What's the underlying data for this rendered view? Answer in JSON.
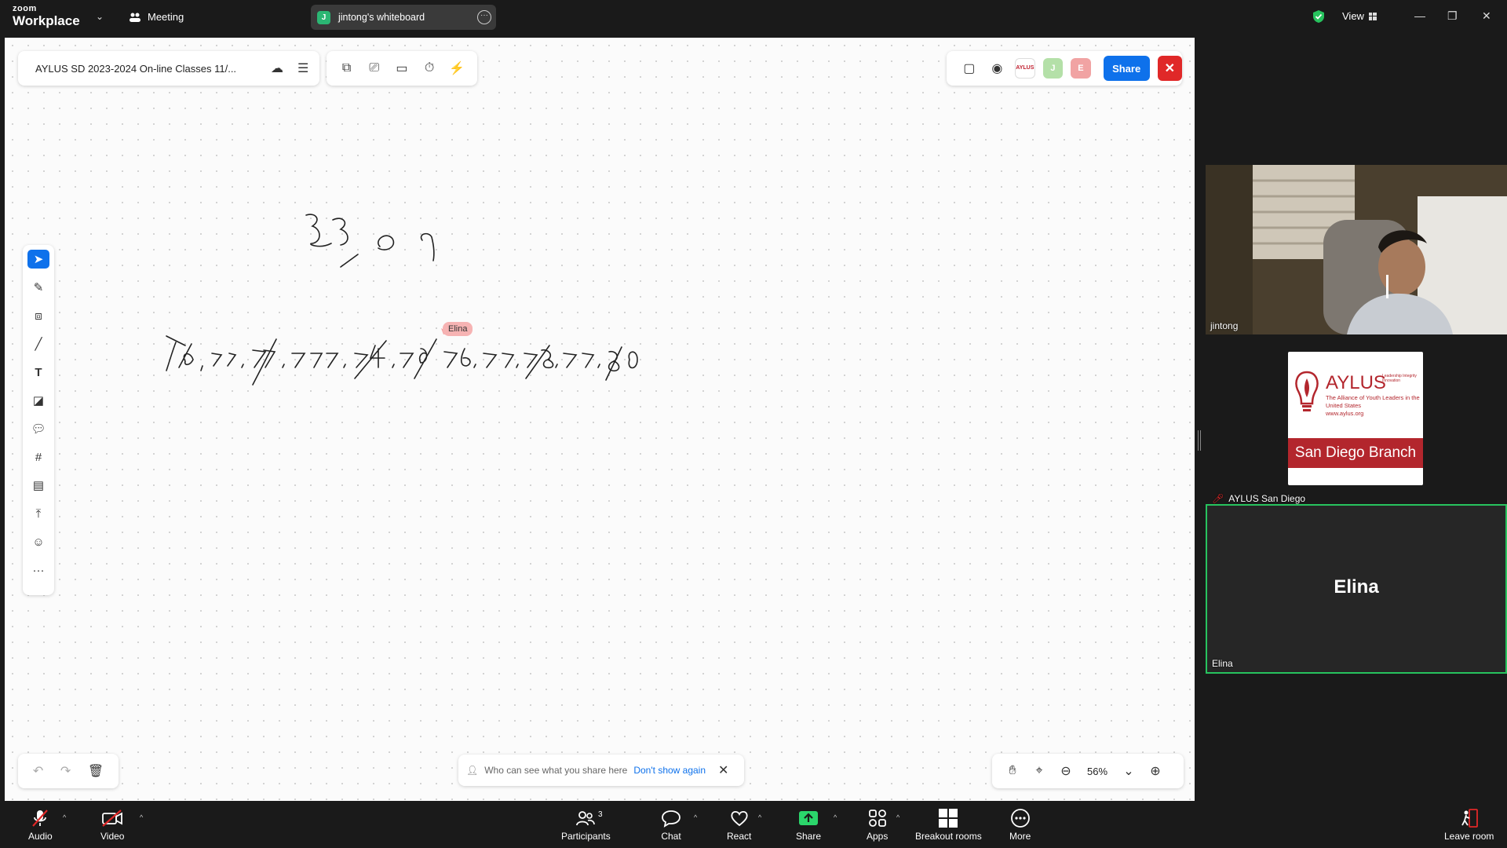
{
  "titlebar": {
    "brand_top": "zoom",
    "brand_bottom": "Workplace",
    "meeting_label": "Meeting",
    "tab_badge": "J",
    "tab_title": "jintong's whiteboard",
    "view_label": "View"
  },
  "whiteboard": {
    "doc_title": "AYLUS SD 2023-2024 On-line Classes 11/...",
    "cursor_label": "Elina",
    "share_label": "Share",
    "avatars": [
      "J",
      "E"
    ],
    "logo_avatar_text": "AYLUS",
    "notice_text": "Who can see what you share here",
    "notice_link": "Don't show again",
    "zoom_level": "56%"
  },
  "participants_panel": {
    "tile1_name": "jintong",
    "tile2_name": "AYLUS San Diego",
    "tile3_name": "Elina",
    "tile3_big": "Elina",
    "logo": {
      "title": "AYLUS",
      "tagline": "The Alliance of Youth Leaders in the United States",
      "url": "www.aylus.org",
      "values": "Leadership Integrity Innovation",
      "branch": "San Diego Branch"
    }
  },
  "bottombar": {
    "audio": "Audio",
    "video": "Video",
    "participants": "Participants",
    "participants_count": "3",
    "chat": "Chat",
    "react": "React",
    "share": "Share",
    "apps": "Apps",
    "breakout": "Breakout rooms",
    "more": "More",
    "leave": "Leave room"
  },
  "colors": {
    "accent": "#0e71eb",
    "danger": "#e02828",
    "active_speaker": "#27c35e",
    "share_green": "#2bd66b"
  }
}
